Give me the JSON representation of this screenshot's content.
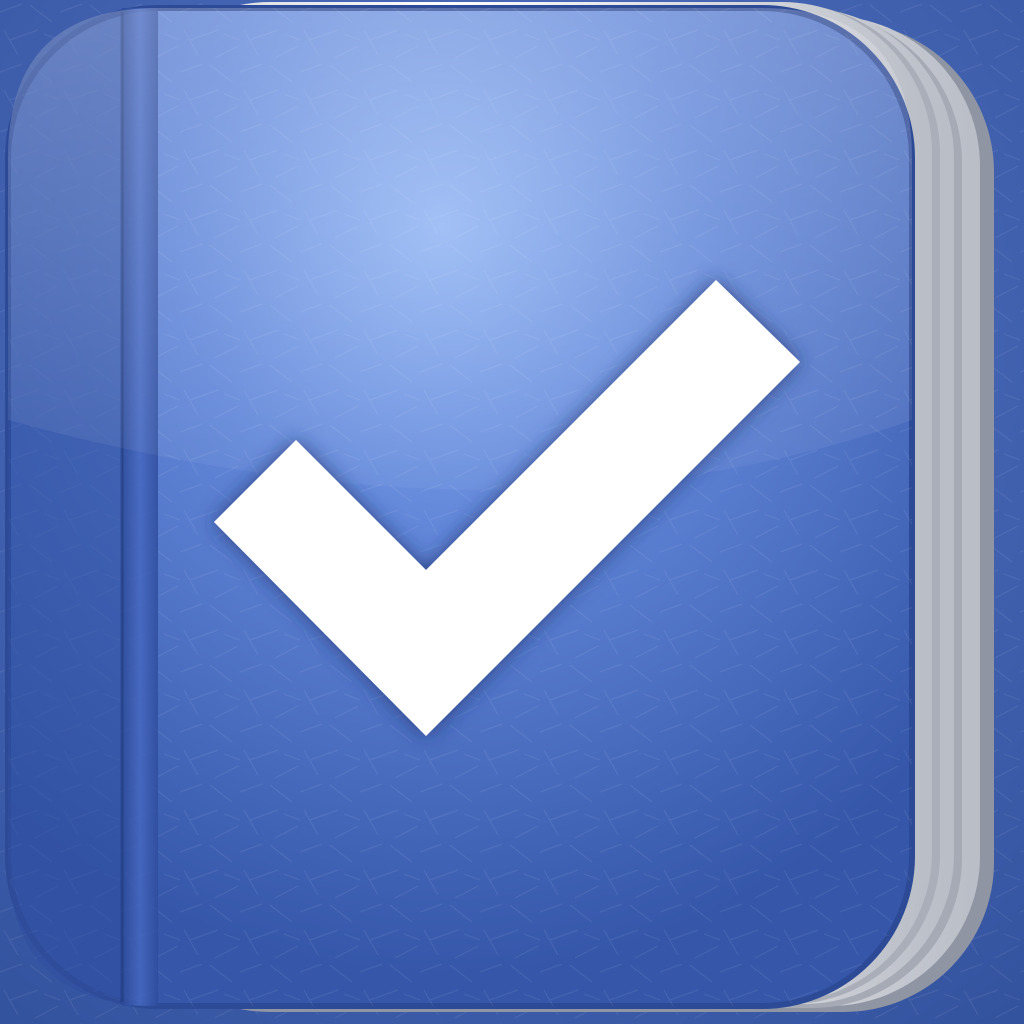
{
  "app_icon": {
    "icon": "checkmark-notebook-icon",
    "colors": {
      "background": "#3d5fb4",
      "cover_light": "#8fb2f2",
      "cover_mid": "#5d82d6",
      "cover_dark": "#3152a6",
      "spine": "#2f4f9e",
      "pages": "#f4f4f6",
      "pages_shadow": "#9aa0ab",
      "checkmark": "#ffffff"
    }
  }
}
